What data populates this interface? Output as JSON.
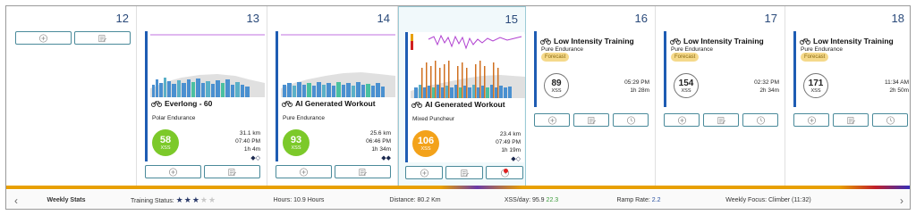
{
  "days": [
    {
      "num": "12"
    },
    {
      "num": "13",
      "workout": {
        "title": "Everlong - 60",
        "type": "Polar Endurance",
        "xss": "58",
        "xss_label": "XSS",
        "distance": "31.1 km",
        "time": "07:40 PM",
        "duration": "1h 4m",
        "color": "green"
      }
    },
    {
      "num": "14",
      "workout": {
        "title": "AI Generated Workout",
        "type": "Pure Endurance",
        "xss": "93",
        "xss_label": "XSS",
        "distance": "25.6 km",
        "time": "06:46 PM",
        "duration": "1h 34m",
        "color": "green"
      }
    },
    {
      "num": "15",
      "workout": {
        "title": "AI Generated Workout",
        "type": "Mixed Puncheur",
        "xss": "106",
        "xss_label": "XSS",
        "distance": "23.4 km",
        "time": "07:49 PM",
        "duration": "1h 19m",
        "color": "orange"
      }
    },
    {
      "num": "16",
      "planned": {
        "title": "Low Intensity Training",
        "type": "Pure Endurance",
        "badge": "Forecast",
        "xss": "89",
        "xss_label": "XSS",
        "time": "05:29 PM",
        "duration": "1h 28m"
      }
    },
    {
      "num": "17",
      "planned": {
        "title": "Low Intensity Training",
        "type": "Pure Endurance",
        "badge": "Forecast",
        "xss": "154",
        "xss_label": "XSS",
        "time": "02:32 PM",
        "duration": "2h 34m"
      }
    },
    {
      "num": "18",
      "planned": {
        "title": "Low Intensity Training",
        "type": "Pure Endurance",
        "badge": "Forecast",
        "xss": "171",
        "xss_label": "XSS",
        "time": "11:34 AM",
        "duration": "2h 50m"
      }
    }
  ],
  "stats": {
    "title": "Weekly Stats",
    "training_status_label": "Training Status:",
    "training_status_stars": 3,
    "hours": "Hours: 10.9 Hours",
    "distance": "Distance: 80.2 Km",
    "xss_day_label": "XSS/day: 95.9",
    "xss_day_delta": "22.3",
    "ramp_label": "Ramp Rate:",
    "ramp_value": "2.2",
    "focus": "Weekly Focus: Climber (11:32)"
  },
  "icons": {
    "prev": "chevron-left-icon",
    "next": "chevron-right-icon",
    "add": "plus-circle-icon",
    "edit": "edit-notes-icon",
    "clock": "clock-icon",
    "bike": "bicycle-icon",
    "star": "star-icon"
  },
  "colors": {
    "accent": "#1e5cb3",
    "xss_green": "#7cc92a",
    "xss_orange": "#f3a21a",
    "forecast_badge": "#f5d98a",
    "button_border": "#4a8a9a",
    "selected_bg": "#f1f9fb"
  }
}
